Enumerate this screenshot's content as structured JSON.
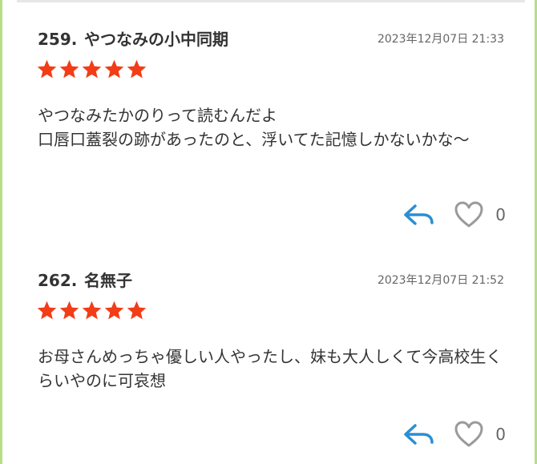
{
  "comments": [
    {
      "number": "259.",
      "name": "やつなみの小中同期",
      "date": "2023年12月07日 21:33",
      "rating": 5,
      "body": "やつなみたかのりって読むんだよ\n口唇口蓋裂の跡があったのと、浮いてた記憶しかないかな〜",
      "likes": "0"
    },
    {
      "number": "262.",
      "name": "名無子",
      "date": "2023年12月07日 21:52",
      "rating": 5,
      "body": "お母さんめっちゃ優しい人やったし、妹も大人しくて今高校生くらいやのに可哀想",
      "likes": "0"
    }
  ],
  "colors": {
    "star": "#f23d17",
    "reply_icon": "#2a8fd0",
    "heart_outline": "#9a9a9a",
    "frame_border": "#b9dd86"
  },
  "icons": {
    "reply": "reply-arrow-icon",
    "like": "heart-outline-icon",
    "star": "star-icon"
  }
}
